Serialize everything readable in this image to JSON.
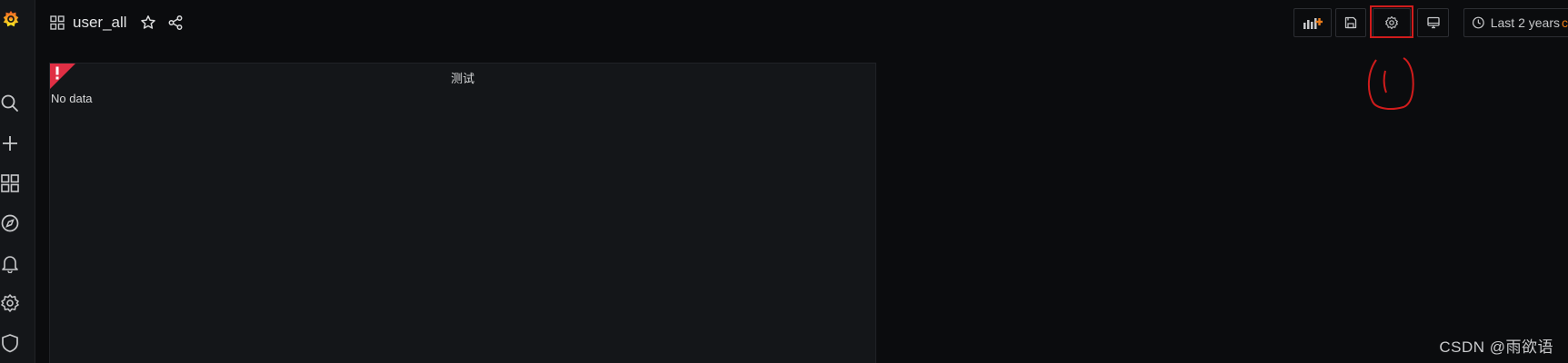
{
  "dashboard": {
    "title": "user_all"
  },
  "sidebar": {
    "items": [
      {
        "icon": "grafana-logo-icon"
      },
      {
        "icon": "search-icon"
      },
      {
        "icon": "plus-icon"
      },
      {
        "icon": "dashboards-icon"
      },
      {
        "icon": "explore-compass-icon"
      },
      {
        "icon": "alerting-bell-icon"
      },
      {
        "icon": "configuration-gear-icon"
      },
      {
        "icon": "server-admin-shield-icon"
      }
    ]
  },
  "toolbar": {
    "buttons": [
      {
        "name": "add-panel-button",
        "icon": "add-panel-icon"
      },
      {
        "name": "save-dashboard-button",
        "icon": "save-icon"
      },
      {
        "name": "dashboard-settings-button",
        "icon": "gear-icon"
      },
      {
        "name": "cycle-view-mode-button",
        "icon": "monitor-icon"
      }
    ],
    "time_picker": {
      "label": "Last 2 years",
      "tail": "c"
    }
  },
  "panel": {
    "title": "测试",
    "message": "No data"
  },
  "watermark": "CSDN @雨欲语",
  "colors": {
    "background": "#0b0c0e",
    "sidebar": "#141619",
    "panel": "#141619",
    "accent_orange": "#eb7b18",
    "error_red": "#e02f44",
    "annotation_red": "#d01c1c"
  }
}
